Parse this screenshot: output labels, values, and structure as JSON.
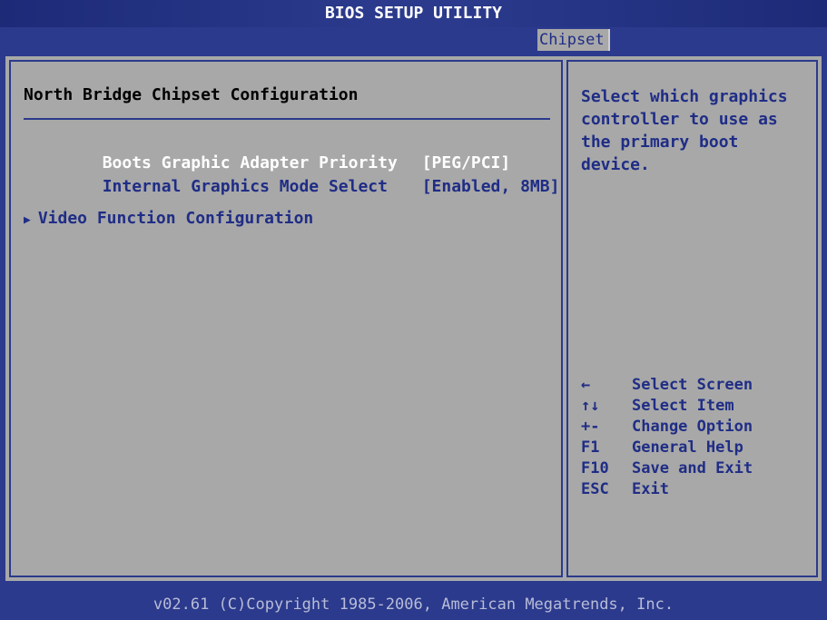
{
  "title": "BIOS SETUP UTILITY",
  "tabs": {
    "active": "Chipset"
  },
  "left": {
    "section_title": "North Bridge Chipset Configuration",
    "settings": [
      {
        "label": "Boots Graphic Adapter Priority",
        "value": "[PEG/PCI]",
        "selected": true
      },
      {
        "label": "Internal Graphics Mode Select",
        "value": "[Enabled, 8MB]",
        "selected": false
      }
    ],
    "submenu": {
      "arrow": "▶",
      "label": "Video Function Configuration"
    }
  },
  "right": {
    "help": "Select which graphics controller to use as the primary boot device.",
    "keys": [
      {
        "key": "←",
        "action": "Select Screen"
      },
      {
        "key": "↑↓",
        "action": "Select Item"
      },
      {
        "key": "+-",
        "action": "Change Option"
      },
      {
        "key": "F1",
        "action": "General Help"
      },
      {
        "key": "F10",
        "action": "Save and Exit"
      },
      {
        "key": "ESC",
        "action": "Exit"
      }
    ]
  },
  "footer": "v02.61 (C)Copyright 1985-2006, American Megatrends, Inc.",
  "colors": {
    "background_blue": "#2b3a8c",
    "panel_gray": "#a8a8a8",
    "text_blue": "#1f2d86",
    "highlight_white": "#ffffff"
  }
}
